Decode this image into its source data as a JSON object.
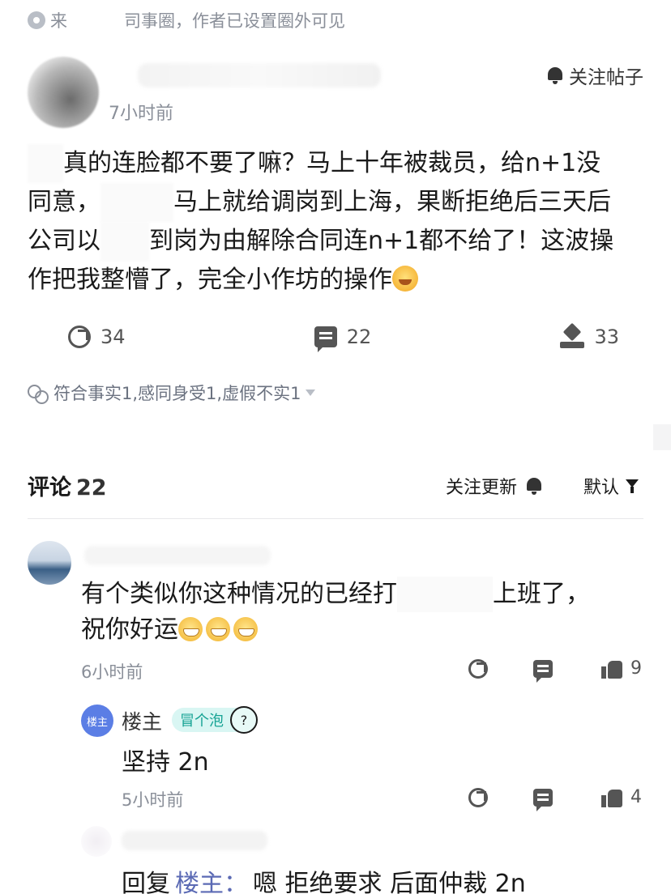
{
  "source": {
    "prefix": "来",
    "suffix": "司事圈，作者已设置圈外可见"
  },
  "post": {
    "time": "7小时前",
    "follow_label": "关注帖子",
    "lines": [
      "真的连脸都不要了嘛？马上十年被裁员，给n+1没",
      "同意，",
      "马上就给调岗到上海，果断拒绝后三天后",
      "公司以",
      "到岗为由解除合同连n+1都不给了！这波操",
      "作把我整懵了，完全小作坊的操作"
    ],
    "stats": {
      "shares": "34",
      "comments": "22",
      "judges": "33"
    },
    "reactions": "符合事实1,感同身受1,虚假不实1"
  },
  "comments_section": {
    "title": "评论",
    "count": "22",
    "follow_updates": "关注更新",
    "sort": "默认"
  },
  "comment1": {
    "text_a": "有个类似你这种情况的已经打",
    "text_b": "上班了，",
    "text_c": "祝你好运",
    "time": "6小时前",
    "likes": "9"
  },
  "reply1": {
    "avatar_label": "楼主",
    "name": "楼主",
    "badge": "冒个泡",
    "badge_icon": "?",
    "text": "坚持 2n",
    "time": "5小时前",
    "likes": "4"
  },
  "reply2": {
    "prefix": "回复",
    "target": "楼主：",
    "text": "嗯 拒绝要求 后面仲裁 2n"
  }
}
